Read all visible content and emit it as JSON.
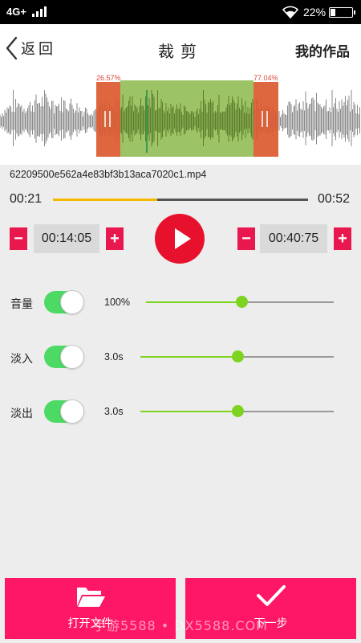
{
  "status_bar": {
    "network": "4G+",
    "battery": "22%",
    "battery_level": 0.22
  },
  "nav": {
    "back_label": "返回",
    "title": "裁剪",
    "right_label": "我的作品"
  },
  "waveform": {
    "left_percent": "26.57%",
    "right_percent": "77.04%"
  },
  "file": {
    "name": "62209500e562a4e83bf3b13aca7020c1.mp4"
  },
  "playback": {
    "current": "00:21",
    "total": "00:52",
    "progress": 0.41
  },
  "trim": {
    "start": "00:14:05",
    "end": "00:40:75",
    "minus": "−",
    "plus": "+"
  },
  "settings": [
    {
      "label": "音量",
      "value": "100%",
      "enabled": true,
      "level": 0.51
    },
    {
      "label": "淡入",
      "value": "3.0s",
      "enabled": true,
      "level": 0.5
    },
    {
      "label": "淡出",
      "value": "3.0s",
      "enabled": true,
      "level": 0.5
    }
  ],
  "actions": {
    "open_file": "打开文件",
    "next_step": "下一步"
  },
  "watermark": "手游5588 • DX5588.COM",
  "colors": {
    "accent": "#fe1766",
    "play": "#e8112d",
    "switch_on": "#4cd964",
    "slider": "#7ed321",
    "progress": "#f5b800",
    "selection": "#8bb84a",
    "handle": "#dc5a30"
  }
}
